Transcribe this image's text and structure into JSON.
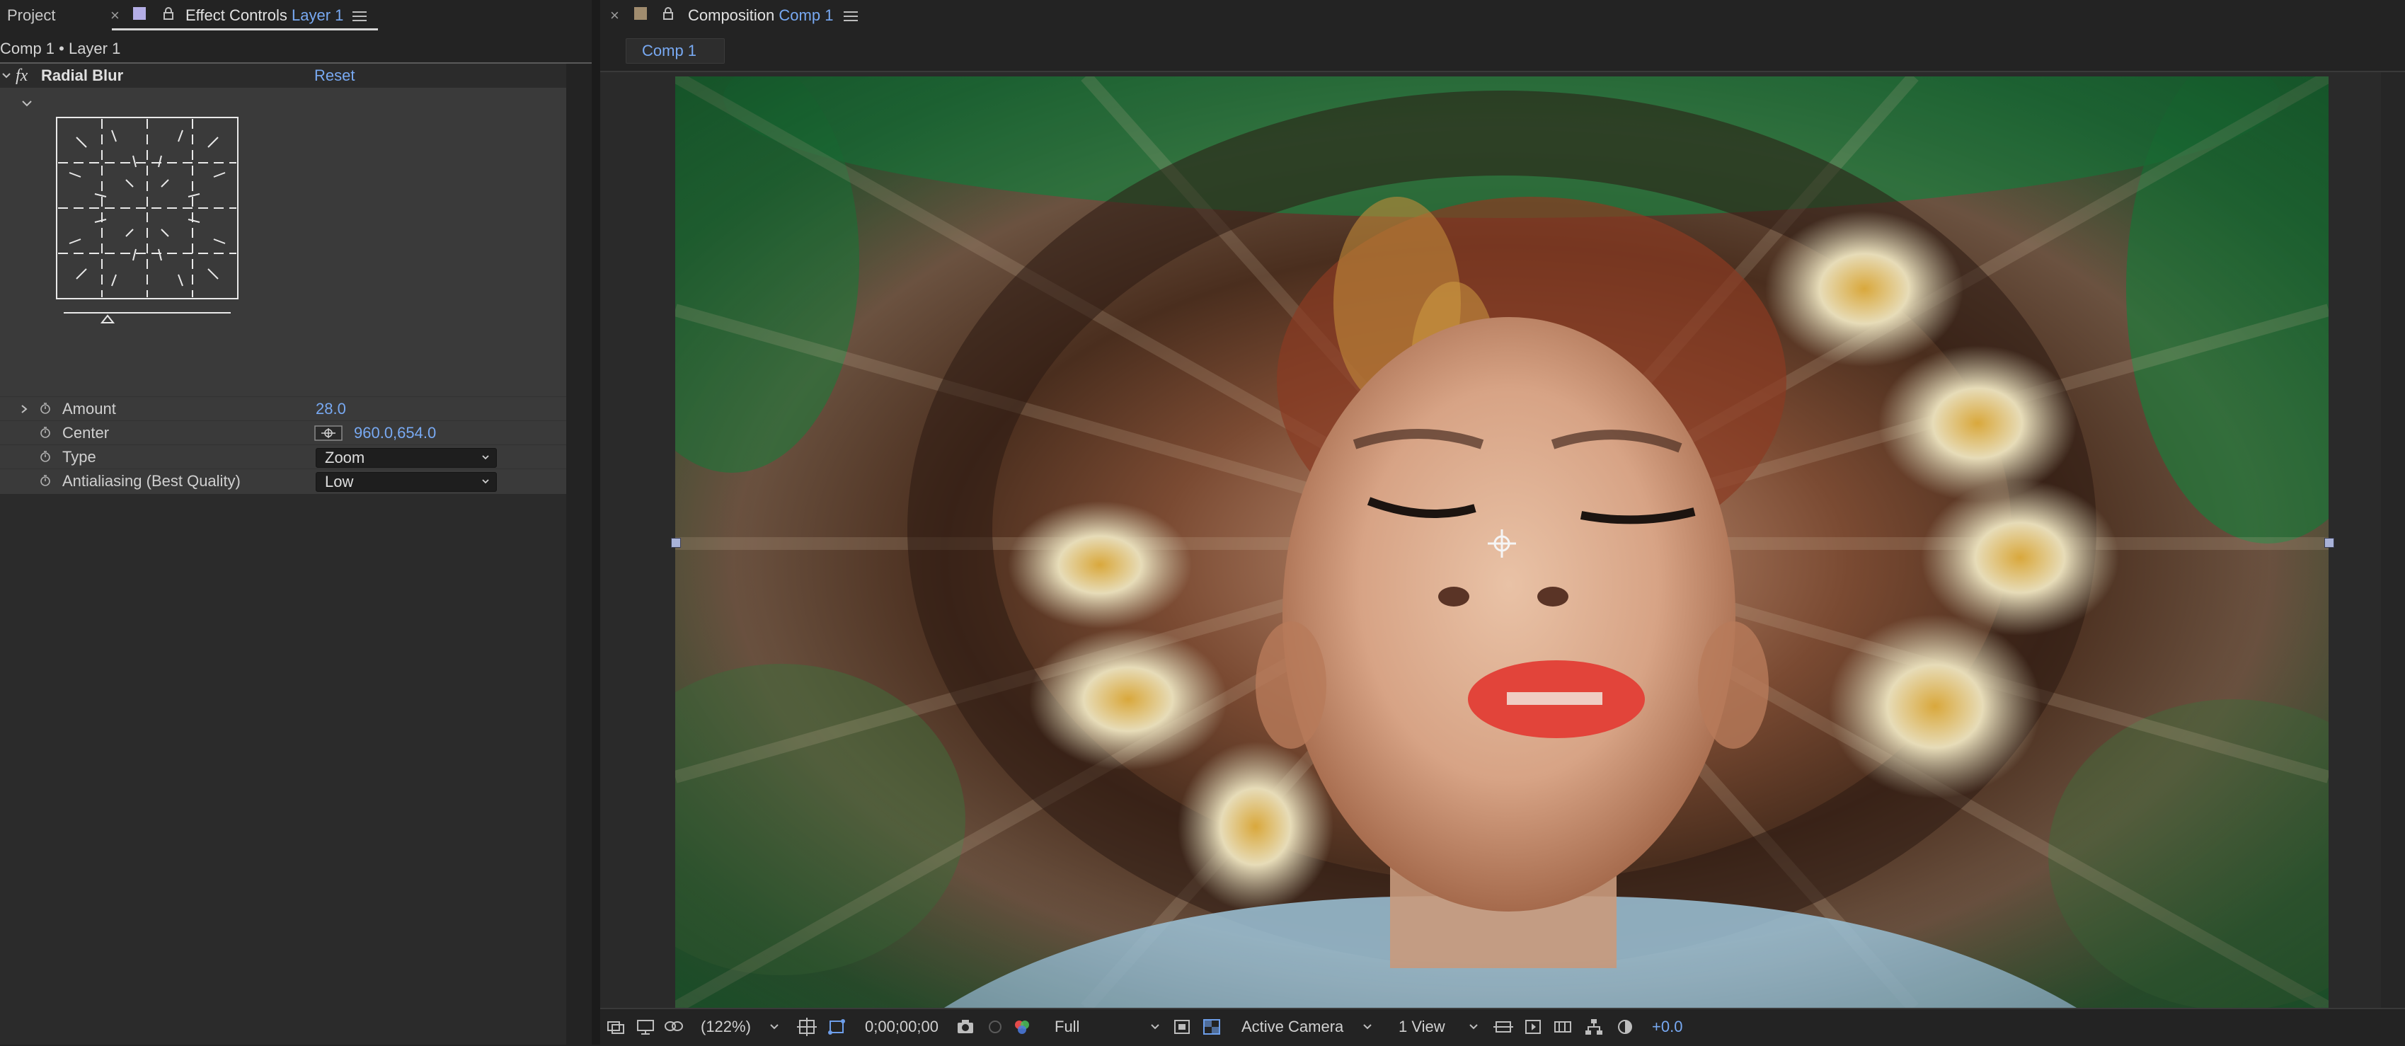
{
  "panels": {
    "project_tab_label": "Project",
    "effect_controls_tab_label": "Effect Controls",
    "effect_controls_layer": "Layer 1",
    "composition_tab_label": "Composition",
    "composition_tab_comp": "Comp 1",
    "close_glyph": "×"
  },
  "effect_controls": {
    "path": "Comp 1 • Layer 1",
    "effect_name": "Radial Blur",
    "fx_glyph": "fx",
    "reset_label": "Reset",
    "properties": [
      {
        "label": "Amount",
        "value": "28.0"
      },
      {
        "label": "Center",
        "value": "960.0,654.0"
      },
      {
        "label": "Type",
        "value": "Zoom"
      },
      {
        "label": "Antialiasing (Best Quality)",
        "value": "Low"
      }
    ]
  },
  "viewer": {
    "comp_tab_button": "Comp 1"
  },
  "statusbar": {
    "zoom": "(122%)",
    "timecode": "0;00;00;00",
    "resolution": "Full",
    "camera": "Active Camera",
    "views": "1 View",
    "exposure": "+0.0"
  },
  "colors": {
    "accent_blue": "#78a9f2",
    "panel_bg": "#232323",
    "effect_bg": "#3a3a3a"
  }
}
